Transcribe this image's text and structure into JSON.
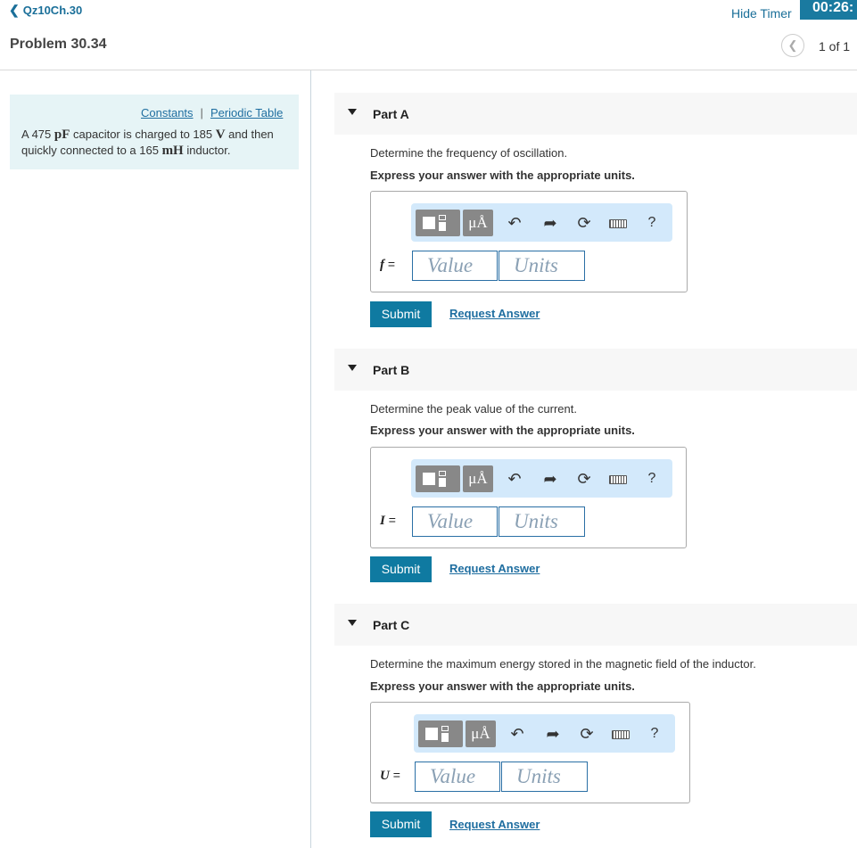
{
  "header": {
    "back_label": "Qz10Ch.30",
    "hide_timer": "Hide Timer",
    "timer": "00:26:"
  },
  "problem": {
    "title": "Problem 30.34",
    "pager_count": "1 of 1"
  },
  "info": {
    "constants": "Constants",
    "separator": "|",
    "periodic_table": "Periodic Table",
    "text_1": "A 475 ",
    "unit_pf": "pF",
    "text_2": " capacitor is charged to 185 ",
    "unit_v": "V",
    "text_3": " and then quickly connected to a 165 ",
    "unit_mh": "mH",
    "text_4": " inductor."
  },
  "toolbar": {
    "mu_label": "μÅ",
    "help_label": "?"
  },
  "parts": [
    {
      "title": "Part A",
      "prompt": "Determine the frequency of oscillation.",
      "express": "Express your answer with the appropriate units.",
      "variable": "f",
      "equals": "=",
      "value_placeholder": "Value",
      "units_placeholder": "Units",
      "submit": "Submit",
      "request": "Request Answer"
    },
    {
      "title": "Part B",
      "prompt": "Determine the peak value of the current.",
      "express": "Express your answer with the appropriate units.",
      "variable": "I",
      "equals": "=",
      "value_placeholder": "Value",
      "units_placeholder": "Units",
      "submit": "Submit",
      "request": "Request Answer"
    },
    {
      "title": "Part C",
      "prompt": "Determine the maximum energy stored in the magnetic field of the inductor.",
      "express": "Express your answer with the appropriate units.",
      "variable": "U",
      "equals": "=",
      "value_placeholder": "Value",
      "units_placeholder": "Units",
      "submit": "Submit",
      "request": "Request Answer"
    }
  ]
}
